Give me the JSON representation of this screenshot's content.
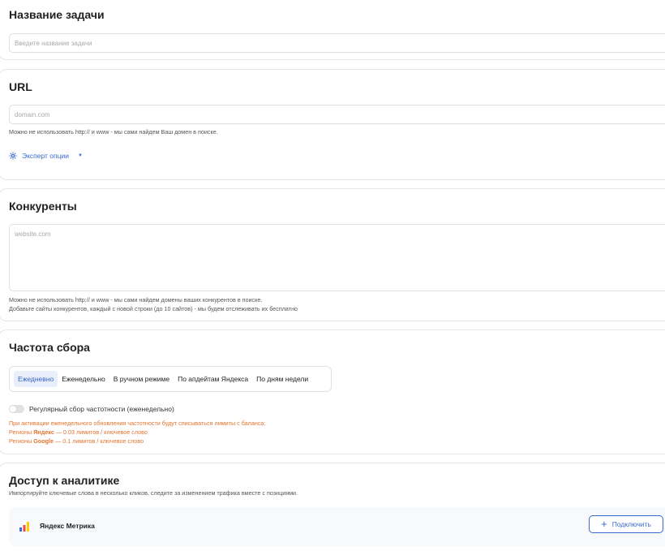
{
  "task_name": {
    "title": "Название задачи",
    "placeholder": "Введите название задачи"
  },
  "url": {
    "title": "URL",
    "placeholder": "domain.com",
    "hint": "Можно не использовать http:// и www - мы сами найдем Ваш домен в поиске.",
    "expert_label": "Эксперт опции",
    "expert_icon": "gear-icon",
    "expert_caret_icon": "caret-down-icon"
  },
  "competitors": {
    "title": "Конкуренты",
    "placeholder": "website.com",
    "hint_line1": "Можно не использовать http:// и www - мы сами найдем домены ваших конкурентов в поиске.",
    "hint_line2": "Добавьте сайты конкурентов, каждый с новой строки (до 10 сайтов) - мы будем отслеживать их бесплатно"
  },
  "frequency": {
    "title": "Частота сбора",
    "options": [
      "Ежедневно",
      "Еженедельно",
      "В ручном режиме",
      "По апдейтам Яндекса",
      "По дням недели"
    ],
    "selected": "Ежедневно",
    "toggle_label": "Регулярный сбор частотности (еженедельно)",
    "toggle_on": false,
    "warning_line1": "При активации еженедельного обновления частотности будут списываться лимиты с баланса:",
    "warning_yandex_prefix": "Регионы ",
    "warning_yandex_name": "Яндекс",
    "warning_yandex_suffix": " — 0.03 лимитов / ключевое слово",
    "warning_google_prefix": "Регионы ",
    "warning_google_name": "Google",
    "warning_google_suffix": " — 0.1 лимитов / ключевое слово",
    "accent_color": "#3a63c8",
    "warning_color": "#e4742f"
  },
  "analytics": {
    "title": "Доступ к аналитике",
    "subtitle": "Импортируйте ключевые слова в несколько кликов, следите за изменением трафика вместе с позициями.",
    "service_name": "Яндекс Метрика",
    "service_icon": "yandex-metrika-icon",
    "connect_label": "Подключить"
  }
}
